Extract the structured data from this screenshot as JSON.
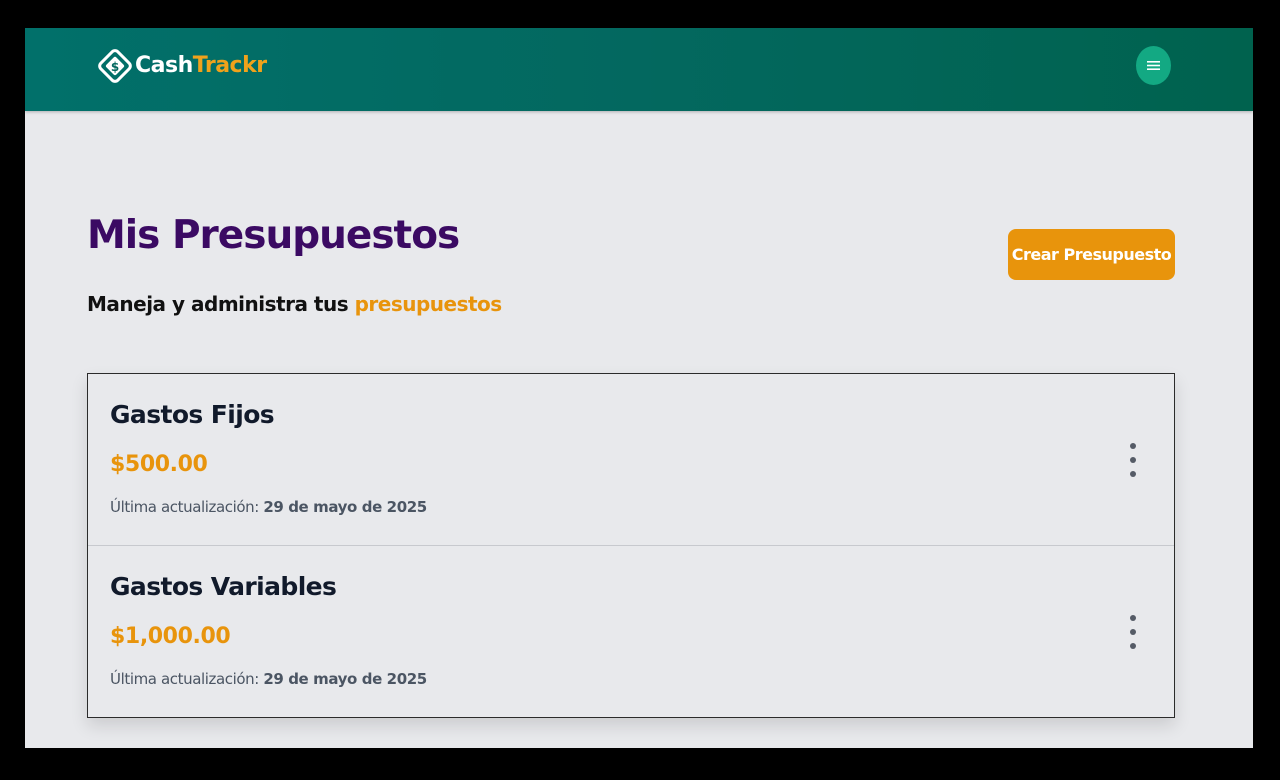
{
  "header": {
    "logo_cash": "Cash",
    "logo_trackr": "Trackr",
    "menu_icon": "hamburger-menu-icon"
  },
  "colors": {
    "brand_green": "#03685f",
    "accent_orange": "#e8940c",
    "title_purple": "#3b0a63"
  },
  "page": {
    "title": "Mis Presupuestos",
    "subtitle_prefix": "Maneja y administra tus ",
    "subtitle_accent": "presupuestos",
    "create_button": "Crear Presupuesto"
  },
  "budgets": [
    {
      "name": "Gastos Fijos",
      "amount": "$500.00",
      "updated_label": "Última actualización: ",
      "updated_date": "29 de mayo de 2025"
    },
    {
      "name": "Gastos Variables",
      "amount": "$1,000.00",
      "updated_label": "Última actualización: ",
      "updated_date": "29 de mayo de 2025"
    }
  ]
}
